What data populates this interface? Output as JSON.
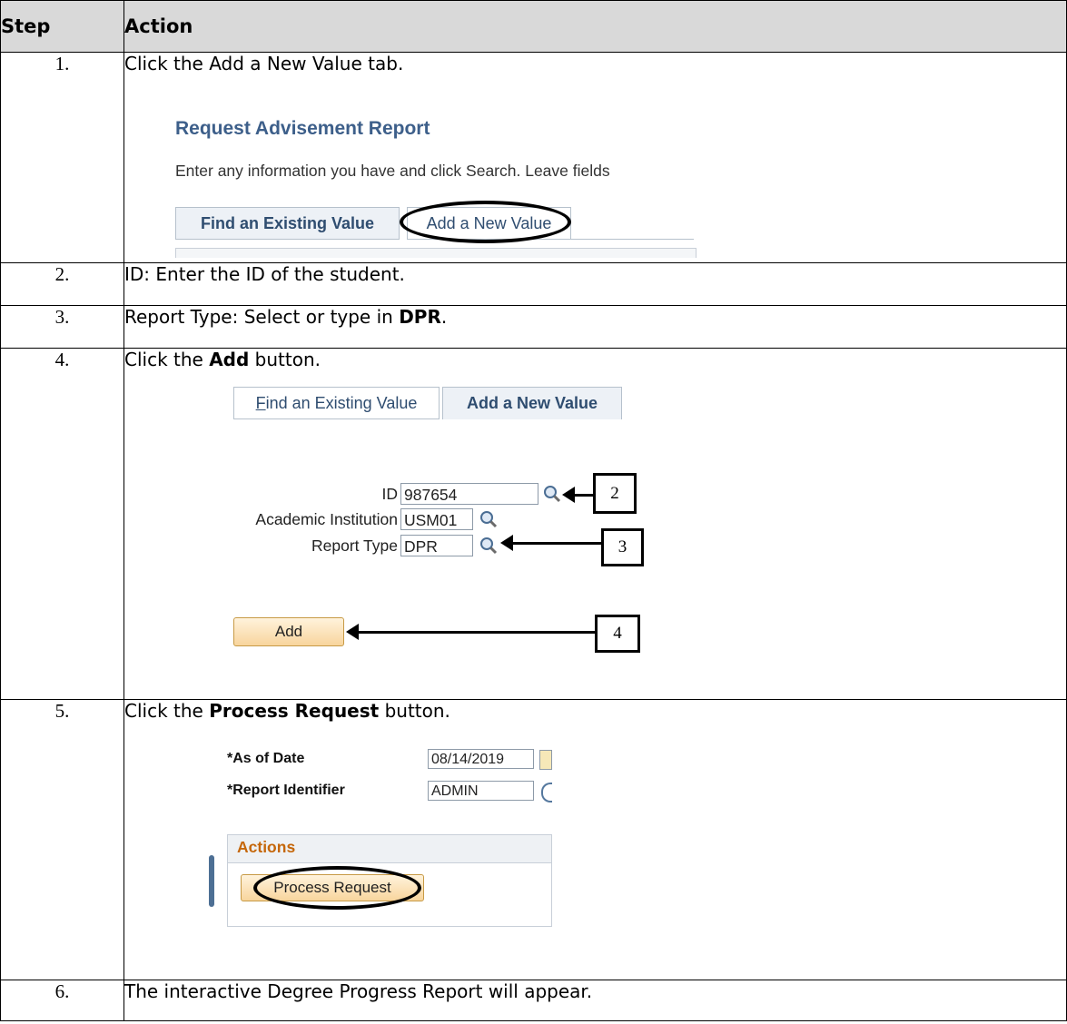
{
  "header": {
    "step": "Step",
    "action": "Action"
  },
  "rows": [
    {
      "num": "1.",
      "text": "Click the Add a New Value tab."
    },
    {
      "num": "2.",
      "text": "ID:  Enter the ID of the student."
    },
    {
      "num": "3.",
      "pre": "Report Type:  Select or type in ",
      "bold": "DPR",
      "post": "."
    },
    {
      "num": "4.",
      "pre": "Click the ",
      "bold": "Add",
      "post": " button."
    },
    {
      "num": "5.",
      "pre": "Click the ",
      "bold": "Process Request",
      "post": " button."
    },
    {
      "num": "6.",
      "text": "The interactive Degree Progress Report will appear."
    }
  ],
  "shot1": {
    "title": "Request Advisement Report",
    "instructions": "Enter any information you have and click Search. Leave fields",
    "tab_find": "Find an Existing Value",
    "tab_add": "Add a New Value"
  },
  "shot2": {
    "tab_find_first": "F",
    "tab_find_rest": "ind an Existing Value",
    "tab_add": "Add a New Value",
    "id_label": "ID",
    "id_value": "987654",
    "inst_label": "Academic Institution",
    "inst_value": "USM01",
    "rtype_label": "Report Type",
    "rtype_value": "DPR",
    "add_button": "Add",
    "callouts": [
      "2",
      "3",
      "4"
    ]
  },
  "shot3": {
    "as_of_label": "*As of Date",
    "as_of_value": "08/14/2019",
    "report_id_label": "*Report Identifier",
    "report_id_value": "ADMIN",
    "actions_label": "Actions",
    "process_button": "Process Request"
  },
  "colors": {
    "header_bg": "#d9d9d9",
    "title_blue": "#3d5f8a",
    "actions_orange": "#c5670a",
    "button_fill": "#f8d59d"
  },
  "icons": [
    "search-icon",
    "calendar-icon",
    "arrow-left-icon"
  ]
}
